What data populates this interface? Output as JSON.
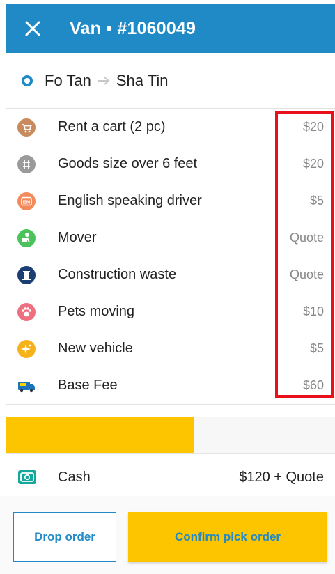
{
  "header": {
    "title": "Van • #1060049",
    "close_icon": "close-icon"
  },
  "route": {
    "from": "Fo Tan",
    "to": "Sha Tin"
  },
  "items": [
    {
      "label": "Rent a cart (2 pc)",
      "price": "$20",
      "icon": "cart-icon",
      "color": "#c98a5e"
    },
    {
      "label": "Goods size over 6 feet",
      "price": "$20",
      "icon": "long-goods-icon",
      "color": "#9a9a9a"
    },
    {
      "label": "English speaking driver",
      "price": "$5",
      "icon": "english-icon",
      "color": "#f28a5b"
    },
    {
      "label": "Mover",
      "price": "Quote",
      "icon": "mover-icon",
      "color": "#4cc35a"
    },
    {
      "label": "Construction waste",
      "price": "Quote",
      "icon": "waste-icon",
      "color": "#1b3e73"
    },
    {
      "label": "Pets moving",
      "price": "$10",
      "icon": "paw-icon",
      "color": "#ee6f7f"
    },
    {
      "label": "New vehicle",
      "price": "$5",
      "icon": "sparkle-icon",
      "color": "#f6b21b"
    },
    {
      "label": "Base Fee",
      "price": "$60",
      "icon": "van-icon",
      "color": "#1e74b8"
    }
  ],
  "progress": {
    "fraction": 0.57,
    "color": "#fdc400"
  },
  "payment": {
    "method": "Cash",
    "total": "$120 + Quote",
    "icon": "cash-icon"
  },
  "buttons": {
    "drop": "Drop order",
    "confirm": "Confirm pick order"
  },
  "colors": {
    "brand_blue": "#1f8ac6",
    "accent_yellow": "#fdc400",
    "highlight_red": "#e8101a"
  }
}
